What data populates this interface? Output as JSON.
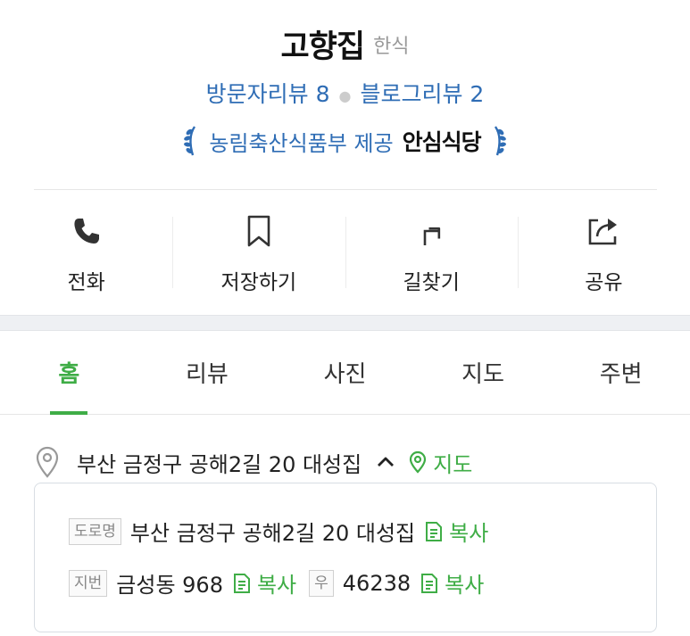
{
  "place": {
    "name": "고향집",
    "category": "한식"
  },
  "reviews": {
    "visitor": "방문자리뷰 8",
    "blog": "블로그리뷰 2"
  },
  "badge": {
    "provider": "농림축산식품부 제공",
    "logo_text": "안심식당"
  },
  "actions": [
    {
      "label": "전화",
      "icon": "phone-icon"
    },
    {
      "label": "저장하기",
      "icon": "bookmark-icon"
    },
    {
      "label": "길찾기",
      "icon": "directions-icon"
    },
    {
      "label": "공유",
      "icon": "share-icon"
    }
  ],
  "tabs": [
    {
      "label": "홈",
      "active": true
    },
    {
      "label": "리뷰",
      "active": false
    },
    {
      "label": "사진",
      "active": false
    },
    {
      "label": "지도",
      "active": false
    },
    {
      "label": "주변",
      "active": false
    }
  ],
  "address": {
    "summary": "부산 금정구 공해2길 20 대성집",
    "map_label": "지도",
    "road_tag": "도로명",
    "road_value": "부산 금정구 공해2길 20 대성집",
    "lot_tag": "지번",
    "lot_value": "금성동 968",
    "postal_tag": "우",
    "postal_value": "46238",
    "copy_label": "복사"
  },
  "colors": {
    "accent_green": "#3fad46",
    "link_blue": "#2f6db5"
  }
}
